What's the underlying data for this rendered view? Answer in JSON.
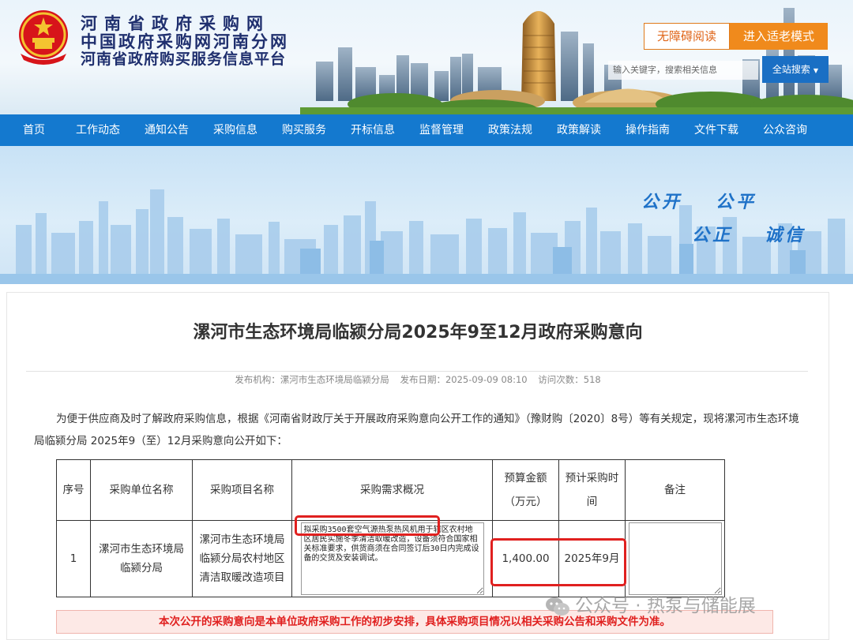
{
  "header": {
    "site_name_line1": "河南省政府采购网",
    "site_name_line2": "中国政府采购网河南分网",
    "site_name_line3": "河南省政府购买服务信息平台",
    "accessibility_button": "无障碍阅读",
    "elder_mode_button": "进入适老模式",
    "search_placeholder": "输入关键字，搜索相关信息",
    "search_button": "全站搜索"
  },
  "nav": {
    "items": [
      "首页",
      "工作动态",
      "通知公告",
      "采购信息",
      "购买服务",
      "开标信息",
      "监督管理",
      "政策法规",
      "政策解读",
      "操作指南",
      "文件下载",
      "公众咨询"
    ]
  },
  "banner": {
    "slogan_1": "公开",
    "slogan_2": "公平",
    "slogan_3": "公正",
    "slogan_4": "诚信"
  },
  "article": {
    "title": "漯河市生态环境局临颍分局2025年9至12月政府采购意向",
    "publisher": "发布机构：漯河市生态环境局临颍分局",
    "publish_date": "发布日期：2025-09-09 08:10",
    "visits": "访问次数：518",
    "intro": "为便于供应商及时了解政府采购信息，根据《河南省财政厅关于开展政府采购意向公开工作的通知》（豫财购〔2020〕8号）等有关规定，现将漯河市生态环境局临颍分局 2025年9（至）12月采购意向公开如下："
  },
  "table": {
    "headers": {
      "seq": "序号",
      "unit": "采购单位名称",
      "project": "采购项目名称",
      "requirement": "采购需求概况",
      "budget_line1": "预算金额",
      "budget_line2": "（万元）",
      "time_line1": "预计采购时",
      "time_line2": "间",
      "remark": "备注"
    },
    "rows": [
      {
        "seq": "1",
        "unit": "漯河市生态环境局临颍分局",
        "project": "漯河市生态环境局临颍分局农村地区清洁取暖改造项目",
        "requirement": "拟采购3500套空气源热泵热风机用于辖区农村地区居民实施冬季清洁取暖改造，设备须符合国家相关标准要求，供货商须在合同签订后30日内完成设备的交货及安装调试。",
        "budget": "1,400.00",
        "time": "2025年9月",
        "remark": ""
      }
    ]
  },
  "notice": "本次公开的采购意向是本单位政府采购工作的初步安排，具体采购项目情况以相关采购公告和采购文件为准。",
  "watermark": "公众号 · 热泵与储能展",
  "colors": {
    "nav_blue": "#1479cf",
    "accent_orange": "#f08a1c",
    "highlight_red": "#e0201f",
    "title_navy": "#1f2f6e"
  }
}
